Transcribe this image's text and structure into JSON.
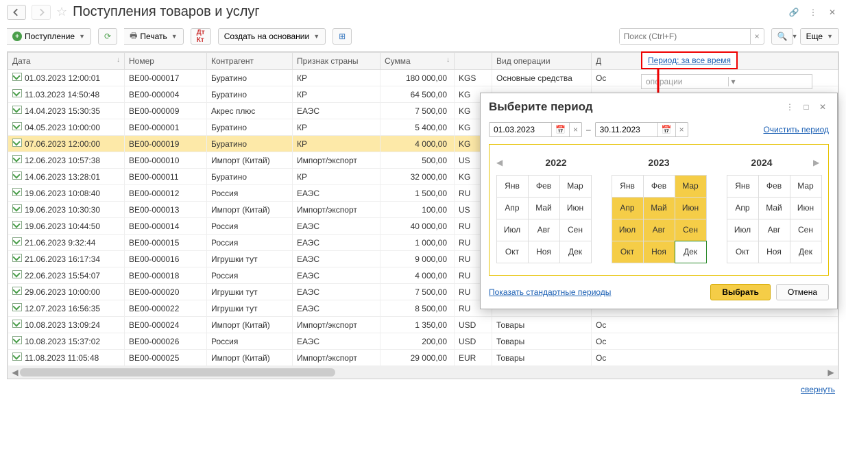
{
  "title": "Поступления товаров и услуг",
  "toolbar": {
    "create": "Поступление",
    "print": "Печать",
    "create_based": "Создать на основании",
    "search_placeholder": "Поиск (Ctrl+F)",
    "more": "Еще"
  },
  "columns": {
    "date": "Дата",
    "number": "Номер",
    "contractor": "Контрагент",
    "country": "Признак страны",
    "sum": "Сумма",
    "currency": "",
    "operation": "Вид операции",
    "extra": "Д"
  },
  "rows": [
    {
      "date": "01.03.2023 12:00:01",
      "num": "BE00-000017",
      "ctr": "Буратино",
      "cty": "КР",
      "sum": "180 000,00",
      "cur": "KGS",
      "op": "Основные средства",
      "ex": "Ос"
    },
    {
      "date": "11.03.2023 14:50:48",
      "num": "BE00-000004",
      "ctr": "Буратино",
      "cty": "КР",
      "sum": "64 500,00",
      "cur": "KG",
      "op": "",
      "ex": ""
    },
    {
      "date": "14.04.2023 15:30:35",
      "num": "BE00-000009",
      "ctr": "Акрес плюс",
      "cty": "ЕАЭС",
      "sum": "7 500,00",
      "cur": "KG",
      "op": "",
      "ex": ""
    },
    {
      "date": "04.05.2023 10:00:00",
      "num": "BE00-000001",
      "ctr": "Буратино",
      "cty": "КР",
      "sum": "5 400,00",
      "cur": "KG",
      "op": "",
      "ex": ""
    },
    {
      "date": "07.06.2023 12:00:00",
      "num": "BE00-000019",
      "ctr": "Буратино",
      "cty": "КР",
      "sum": "4 000,00",
      "cur": "KG",
      "op": "",
      "ex": "",
      "sel": true
    },
    {
      "date": "12.06.2023 10:57:38",
      "num": "BE00-000010",
      "ctr": "Импорт (Китай)",
      "cty": "Импорт/экспорт",
      "sum": "500,00",
      "cur": "US",
      "op": "",
      "ex": ""
    },
    {
      "date": "14.06.2023 13:28:01",
      "num": "BE00-000011",
      "ctr": "Буратино",
      "cty": "КР",
      "sum": "32 000,00",
      "cur": "KG",
      "op": "",
      "ex": ""
    },
    {
      "date": "19.06.2023 10:08:40",
      "num": "BE00-000012",
      "ctr": "Россия",
      "cty": "ЕАЭС",
      "sum": "1 500,00",
      "cur": "RU",
      "op": "",
      "ex": ""
    },
    {
      "date": "19.06.2023 10:30:30",
      "num": "BE00-000013",
      "ctr": "Импорт (Китай)",
      "cty": "Импорт/экспорт",
      "sum": "100,00",
      "cur": "US",
      "op": "",
      "ex": ""
    },
    {
      "date": "19.06.2023 10:44:50",
      "num": "BE00-000014",
      "ctr": "Россия",
      "cty": "ЕАЭС",
      "sum": "40 000,00",
      "cur": "RU",
      "op": "",
      "ex": ""
    },
    {
      "date": "21.06.2023 9:32:44",
      "num": "BE00-000015",
      "ctr": "Россия",
      "cty": "ЕАЭС",
      "sum": "1 000,00",
      "cur": "RU",
      "op": "",
      "ex": ""
    },
    {
      "date": "21.06.2023 16:17:34",
      "num": "BE00-000016",
      "ctr": "Игрушки тут",
      "cty": "ЕАЭС",
      "sum": "9 000,00",
      "cur": "RU",
      "op": "",
      "ex": ""
    },
    {
      "date": "22.06.2023 15:54:07",
      "num": "BE00-000018",
      "ctr": "Россия",
      "cty": "ЕАЭС",
      "sum": "4 000,00",
      "cur": "RU",
      "op": "",
      "ex": ""
    },
    {
      "date": "29.06.2023 10:00:00",
      "num": "BE00-000020",
      "ctr": "Игрушки тут",
      "cty": "ЕАЭС",
      "sum": "7 500,00",
      "cur": "RU",
      "op": "",
      "ex": ""
    },
    {
      "date": "12.07.2023 16:56:35",
      "num": "BE00-000022",
      "ctr": "Игрушки тут",
      "cty": "ЕАЭС",
      "sum": "8 500,00",
      "cur": "RU",
      "op": "",
      "ex": ""
    },
    {
      "date": "10.08.2023 13:09:24",
      "num": "BE00-000024",
      "ctr": "Импорт (Китай)",
      "cty": "Импорт/экспорт",
      "sum": "1 350,00",
      "cur": "USD",
      "op": "Товары",
      "ex": "Ос"
    },
    {
      "date": "10.08.2023 15:37:02",
      "num": "BE00-000026",
      "ctr": "Россия",
      "cty": "ЕАЭС",
      "sum": "200,00",
      "cur": "USD",
      "op": "Товары",
      "ex": "Ос"
    },
    {
      "date": "11.08.2023 11:05:48",
      "num": "BE00-000025",
      "ctr": "Импорт (Китай)",
      "cty": "Импорт/экспорт",
      "sum": "29 000,00",
      "cur": "EUR",
      "op": "Товары",
      "ex": "Ос"
    }
  ],
  "side_field_placeholder": "операции",
  "period_link": "Период: за все время",
  "bottom_link": "свернуть",
  "dialog": {
    "title": "Выберите период",
    "from": "01.03.2023",
    "to": "30.11.2023",
    "clear": "Очистить период",
    "years": [
      "2022",
      "2023",
      "2024"
    ],
    "months": [
      "Янв",
      "Фев",
      "Мар",
      "Апр",
      "Май",
      "Июн",
      "Июл",
      "Авг",
      "Сен",
      "Окт",
      "Ноя",
      "Дек"
    ],
    "show_std": "Показать стандартные периоды",
    "ok": "Выбрать",
    "cancel": "Отмена",
    "hl_year": 1,
    "hl_start": 2,
    "hl_end": 10,
    "end_idx": 11
  }
}
